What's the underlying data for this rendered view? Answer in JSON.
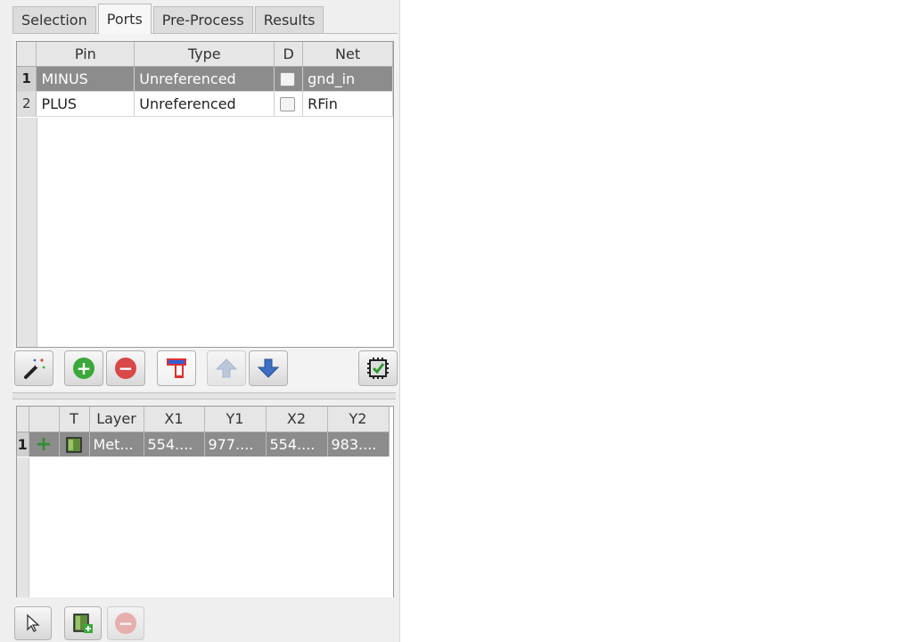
{
  "tabs": [
    {
      "label": "Selection",
      "active": false
    },
    {
      "label": "Ports",
      "active": true
    },
    {
      "label": "Pre-Process",
      "active": false
    },
    {
      "label": "Results",
      "active": false
    }
  ],
  "ports_table": {
    "headers": {
      "pin": "Pin",
      "type": "Type",
      "d": "D",
      "net": "Net"
    },
    "rows": [
      {
        "num": "1",
        "pin": "MINUS",
        "type": "Unreferenced",
        "d": false,
        "net": "gnd_in",
        "selected": true
      },
      {
        "num": "2",
        "pin": "PLUS",
        "type": "Unreferenced",
        "d": false,
        "net": "RFin",
        "selected": false
      }
    ]
  },
  "ports_toolbar": [
    {
      "name": "magic-wand-icon",
      "enabled": true
    },
    {
      "name": "add-port-icon",
      "enabled": true
    },
    {
      "name": "remove-port-icon",
      "enabled": true
    },
    {
      "name": "port-edit-icon",
      "enabled": true
    },
    {
      "name": "move-up-icon",
      "enabled": false
    },
    {
      "name": "move-down-icon",
      "enabled": true
    },
    {
      "name": "validate-icon",
      "enabled": true
    }
  ],
  "shapes_table": {
    "headers": {
      "blank": "",
      "t": "T",
      "layer": "Layer",
      "x1": "X1",
      "y1": "Y1",
      "x2": "X2",
      "y2": "Y2"
    },
    "rows": [
      {
        "num": "1",
        "layer": "Met...",
        "x1": "554....",
        "y1": "977....",
        "x2": "554....",
        "y2": "983...."
      }
    ]
  },
  "shapes_toolbar": [
    {
      "name": "select-pointer-icon",
      "enabled": true
    },
    {
      "name": "add-shape-icon",
      "enabled": true
    },
    {
      "name": "remove-shape-icon",
      "enabled": false
    }
  ],
  "colors": {
    "selected_row": "#8c8c8c",
    "add_green": "#3aa83a",
    "remove_red": "#d84848",
    "arrow_blue": "#3d6fc4"
  }
}
